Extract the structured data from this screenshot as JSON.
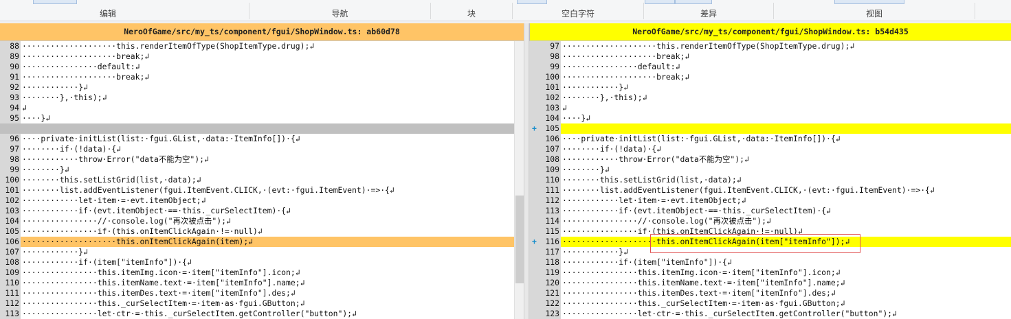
{
  "ribbon": {
    "groups": [
      "编辑",
      "导航",
      "块",
      "空白字符",
      "差异",
      "视图"
    ]
  },
  "left": {
    "title": "NeroOfGame/src/my_ts/component/fgui/ShopWindow.ts: ab60d78",
    "lines": [
      {
        "n": "88",
        "t": "····················this.renderItemOfType(ShopItemType.drug);↲"
      },
      {
        "n": "89",
        "t": "····················break;↲"
      },
      {
        "n": "90",
        "t": "················default:↲"
      },
      {
        "n": "91",
        "t": "····················break;↲"
      },
      {
        "n": "92",
        "t": "············}↲"
      },
      {
        "n": "93",
        "t": "········},·this);↲"
      },
      {
        "n": "94",
        "t": "↲"
      },
      {
        "n": "95",
        "t": "····}↲"
      },
      {
        "n": "",
        "t": "",
        "type": "gap"
      },
      {
        "n": "96",
        "t": "····private·initList(list:·fgui.GList,·data:·ItemInfo[])·{↲"
      },
      {
        "n": "97",
        "t": "········if·(!data)·{↲"
      },
      {
        "n": "98",
        "t": "············throw·Error(\"data不能为空\");↲"
      },
      {
        "n": "99",
        "t": "········}↲"
      },
      {
        "n": "100",
        "t": "········this.setListGrid(list,·data);↲"
      },
      {
        "n": "101",
        "t": "········list.addEventListener(fgui.ItemEvent.CLICK,·(evt:·fgui.ItemEvent)·=>·{↲"
      },
      {
        "n": "102",
        "t": "············let·item·=·evt.itemObject;↲"
      },
      {
        "n": "103",
        "t": "············if·(evt.itemObject·==·this._curSelectItem)·{↲"
      },
      {
        "n": "104",
        "t": "················//·console.log(\"再次被点击\");↲"
      },
      {
        "n": "105",
        "t": "················if·(this.onItemClickAgain·!=·null)↲"
      },
      {
        "n": "106",
        "t": "····················this.onItemClickAgain(item);↲",
        "type": "changed"
      },
      {
        "n": "107",
        "t": "············}↲"
      },
      {
        "n": "108",
        "t": "············if·(item[\"itemInfo\"])·{↲"
      },
      {
        "n": "109",
        "t": "················this.itemImg.icon·=·item[\"itemInfo\"].icon;↲"
      },
      {
        "n": "110",
        "t": "················this.itemName.text·=·item[\"itemInfo\"].name;↲"
      },
      {
        "n": "111",
        "t": "················this.itemDes.text·=·item[\"itemInfo\"].des;↲"
      },
      {
        "n": "112",
        "t": "················this._curSelectItem·=·item·as·fgui.GButton;↲"
      },
      {
        "n": "113",
        "t": "················let·ctr·=·this._curSelectItem.getController(\"button\");↲"
      }
    ]
  },
  "right": {
    "title": "NeroOfGame/src/my_ts/component/fgui/ShopWindow.ts: b54d435",
    "lines": [
      {
        "n": "97",
        "t": "····················this.renderItemOfType(ShopItemType.drug);↲"
      },
      {
        "n": "98",
        "t": "····················break;↲"
      },
      {
        "n": "99",
        "t": "················default:↲"
      },
      {
        "n": "100",
        "t": "····················break;↲"
      },
      {
        "n": "101",
        "t": "············}↲"
      },
      {
        "n": "102",
        "t": "········},·this);↲"
      },
      {
        "n": "103",
        "t": "↲"
      },
      {
        "n": "104",
        "t": "····}↲"
      },
      {
        "n": "105",
        "t": "",
        "type": "added",
        "mark": "+"
      },
      {
        "n": "106",
        "t": "····private·initList(list:·fgui.GList,·data:·ItemInfo[])·{↲"
      },
      {
        "n": "107",
        "t": "········if·(!data)·{↲"
      },
      {
        "n": "108",
        "t": "············throw·Error(\"data不能为空\");↲"
      },
      {
        "n": "109",
        "t": "········}↲"
      },
      {
        "n": "110",
        "t": "········this.setListGrid(list,·data);↲"
      },
      {
        "n": "111",
        "t": "········list.addEventListener(fgui.ItemEvent.CLICK,·(evt:·fgui.ItemEvent)·=>·{↲"
      },
      {
        "n": "112",
        "t": "············let·item·=·evt.itemObject;↲"
      },
      {
        "n": "113",
        "t": "············if·(evt.itemObject·==·this._curSelectItem)·{↲"
      },
      {
        "n": "114",
        "t": "················//·console.log(\"再次被点击\");↲"
      },
      {
        "n": "115",
        "t": "················if·(this.onItemClickAgain·!=·null)↲"
      },
      {
        "n": "116",
        "t": "····················this.onItemClickAgain(item[\"itemInfo\"]);↲",
        "type": "added",
        "mark": "+"
      },
      {
        "n": "117",
        "t": "············}↲"
      },
      {
        "n": "118",
        "t": "············if·(item[\"itemInfo\"])·{↲"
      },
      {
        "n": "119",
        "t": "················this.itemImg.icon·=·item[\"itemInfo\"].icon;↲"
      },
      {
        "n": "120",
        "t": "················this.itemName.text·=·item[\"itemInfo\"].name;↲"
      },
      {
        "n": "121",
        "t": "················this.itemDes.text·=·item[\"itemInfo\"].des;↲"
      },
      {
        "n": "122",
        "t": "················this._curSelectItem·=·item·as·fgui.GButton;↲"
      },
      {
        "n": "123",
        "t": "················let·ctr·=·this._curSelectItem.getController(\"button\");↲"
      }
    ]
  }
}
